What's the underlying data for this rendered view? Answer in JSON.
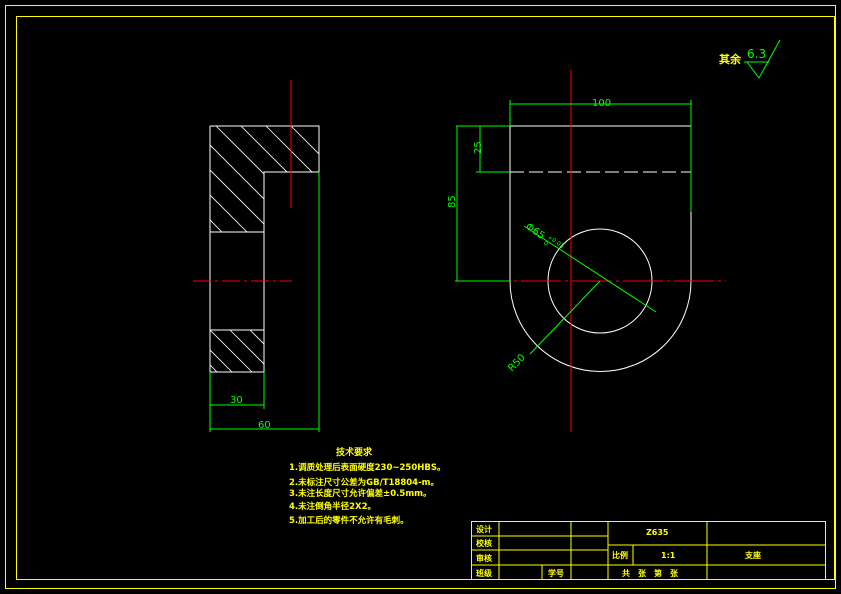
{
  "dimensions": {
    "width_100": "100",
    "depth_25": "25",
    "height_85": "85",
    "hole_dia": "Φ65",
    "hole_tol_upper": "+0.03",
    "hole_tol_lower": "0",
    "radius_50": "R50",
    "width_30": "30",
    "width_60": "60"
  },
  "roughness": {
    "label": "其余",
    "value": "6.3"
  },
  "technical_notes": {
    "title": "技术要求",
    "items": [
      "1.调质处理后表面硬度230~250HBS。",
      "2.未标注尺寸公差为GB/T18804-m。",
      "3.未注长度尺寸允许偏差±0.5mm。",
      "4.未注倒角半径2X2。",
      "5.加工后的零件不允许有毛刺。"
    ]
  },
  "title_block": {
    "design": "设计",
    "check": "校核",
    "review": "审核",
    "class": "班级",
    "student_no": "学号",
    "part_name": "Z635",
    "scale_label": "比例",
    "scale_value": "1:1",
    "sheet_info": "共　张　第　张",
    "material": "支座"
  }
}
